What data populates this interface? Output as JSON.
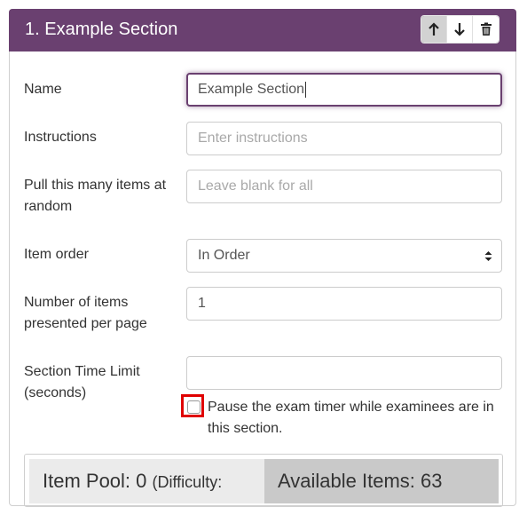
{
  "section": {
    "title": "1. Example Section",
    "controls": {
      "move_up_icon": "arrow-up-icon",
      "move_down_icon": "arrow-down-icon",
      "delete_icon": "trash-icon"
    }
  },
  "form": {
    "name_label": "Name",
    "name_value": "Example Section",
    "instructions_label": "Instructions",
    "instructions_placeholder": "Enter instructions",
    "pull_label_line1": "Pull this many items at",
    "pull_label_line2": "random",
    "pull_placeholder": "Leave blank for all",
    "order_label": "Item order",
    "order_value": "In Order",
    "per_page_label_line1": "Number of items",
    "per_page_label_line2": "presented per page",
    "per_page_value": "1",
    "time_label_line1": "Section Time Limit",
    "time_label_line2": "(seconds)",
    "time_value": "",
    "pause_timer_text": "Pause the exam timer while examinees are in this section.",
    "pause_timer_checked": false
  },
  "pool": {
    "item_pool_label": "Item Pool: 0",
    "difficulty_label": "(Difficulty:",
    "available_items_label": "Available Items: 63"
  },
  "colors": {
    "header_bg": "#6a4070",
    "highlight_outline": "#e00000"
  }
}
